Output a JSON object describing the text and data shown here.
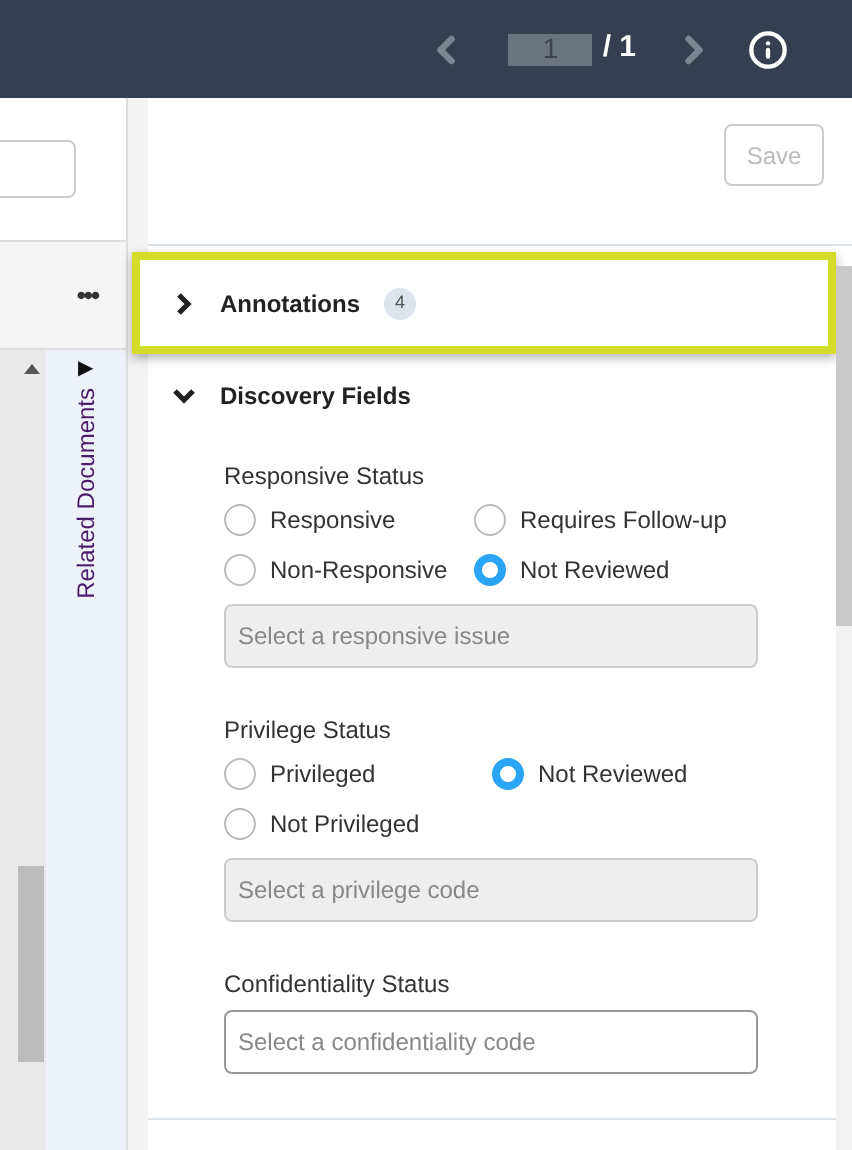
{
  "pager": {
    "page": "1",
    "total": "/ 1"
  },
  "left_pane": {
    "more": "•••",
    "related_tab": "Related Documents",
    "related_arrow": "▶"
  },
  "save_button": {
    "label": "Save",
    "disabled": true
  },
  "sections": [
    {
      "title": "Annotations",
      "count": "4",
      "expanded": false,
      "highlighted": true
    },
    {
      "title": "Discovery Fields",
      "expanded": true,
      "highlighted": false
    }
  ],
  "fields": [
    {
      "label": "Responsive Status",
      "options": [
        {
          "label": "Responsive",
          "selected": false
        },
        {
          "label": "Requires Follow-up",
          "selected": false
        },
        {
          "label": "Non-Responsive",
          "selected": false
        },
        {
          "label": "Not Reviewed",
          "selected": true
        }
      ],
      "select": {
        "placeholder": "Select a responsive issue",
        "disabled": true
      }
    },
    {
      "label": "Privilege Status",
      "options": [
        {
          "label": "Privileged",
          "selected": false
        },
        {
          "label": "Not Reviewed",
          "selected": true
        },
        {
          "label": "Not Privileged",
          "selected": false
        }
      ],
      "select": {
        "placeholder": "Select a privilege code",
        "disabled": true
      }
    },
    {
      "label": "Confidentiality Status",
      "select": {
        "placeholder": "Select a confidentiality code",
        "disabled": false
      }
    }
  ]
}
